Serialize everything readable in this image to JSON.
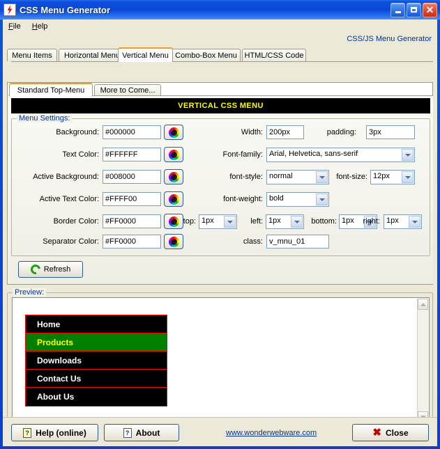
{
  "window": {
    "title": "CSS Menu Generator",
    "icon": "lightning-bolt-icon",
    "minimize_label": "_",
    "maximize_label": "□",
    "close_label": "✕"
  },
  "menubar": {
    "items": [
      "File",
      "Help"
    ]
  },
  "brand": {
    "label": "CSS/JS Menu Generator"
  },
  "tabs": {
    "items": [
      {
        "label": "Menu Items",
        "selected": false
      },
      {
        "label": "Horizontal Menu",
        "selected": false
      },
      {
        "label": "Vertical Menu",
        "selected": true
      },
      {
        "label": "Combo-Box Menu",
        "selected": false
      },
      {
        "label": "HTML/CSS Code",
        "selected": false
      }
    ]
  },
  "inner_tabs": {
    "items": [
      {
        "label": "Standard Top-Menu",
        "selected": true
      },
      {
        "label": "More to Come...",
        "selected": false
      }
    ]
  },
  "banner": {
    "label": "VERTICAL CSS MENU"
  },
  "settings": {
    "legend": "Menu Settings:",
    "color_fields": [
      {
        "label": "Background:",
        "value": "#000000",
        "picker": "color-wheel-icon"
      },
      {
        "label": "Text Color:",
        "value": "#FFFFFF",
        "picker": "color-wheel-icon"
      },
      {
        "label": "Active Background:",
        "value": "#008000",
        "picker": "color-wheel-icon"
      },
      {
        "label": "Active Text Color:",
        "value": "#FFFF00",
        "picker": "color-wheel-icon"
      },
      {
        "label": "Border Color:",
        "value": "#FF0000",
        "picker": "color-wheel-icon"
      },
      {
        "label": "Separator Color:",
        "value": "#FF0000",
        "picker": "color-wheel-icon"
      }
    ],
    "width": {
      "label": "Width:",
      "value": "200px"
    },
    "padding": {
      "label": "padding:",
      "value": "3px"
    },
    "font_family": {
      "label": "Font-family:",
      "value": "Arial, Helvetica, sans-serif"
    },
    "font_style": {
      "label": "font-style:",
      "value": "normal"
    },
    "font_size": {
      "label": "font-size:",
      "value": "12px"
    },
    "font_weight": {
      "label": "font-weight:",
      "value": "bold"
    },
    "border_top": {
      "label": "top:",
      "value": "1px"
    },
    "border_left": {
      "label": "left:",
      "value": "1px"
    },
    "border_bottom": {
      "label": "bottom:",
      "value": "1px"
    },
    "border_right": {
      "label": "right:",
      "value": "1px"
    },
    "css_class": {
      "label": "class:",
      "value": "v_mnu_01"
    }
  },
  "refresh": {
    "label": "Refresh",
    "icon": "refresh-icon"
  },
  "preview": {
    "legend": "Preview:",
    "menu_items": [
      {
        "label": "Home",
        "active": false
      },
      {
        "label": "Products",
        "active": true
      },
      {
        "label": "Downloads",
        "active": false
      },
      {
        "label": "Contact Us",
        "active": false
      },
      {
        "label": "About Us",
        "active": false
      }
    ],
    "colors": {
      "background": "#000000",
      "text": "#FFFFFF",
      "active_background": "#008000",
      "active_text": "#FFFF00",
      "border": "#FF0000",
      "separator": "#FF0000"
    }
  },
  "footer": {
    "help_label": "Help (online)",
    "help_icon": "question-page-icon",
    "about_label": "About",
    "about_icon": "question-page-icon",
    "website": "www.wonderwebware.com",
    "close_label": "Close",
    "close_icon": "red-x-icon"
  }
}
